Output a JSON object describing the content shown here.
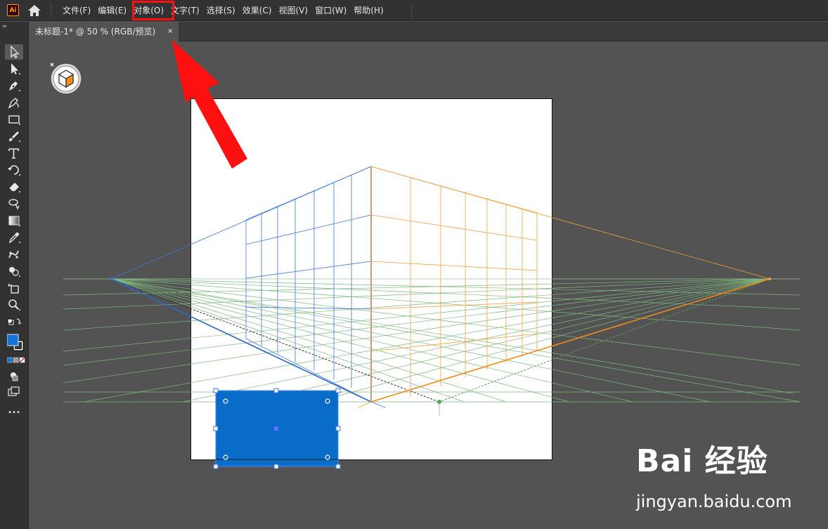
{
  "app": {
    "logo_text": "Ai"
  },
  "menu": {
    "items": [
      "文件(F)",
      "编辑(E)",
      "对象(O)",
      "文字(T)",
      "选择(S)",
      "效果(C)",
      "视图(V)",
      "窗口(W)",
      "帮助(H)"
    ],
    "highlighted_item": "对象(O)"
  },
  "document_tab": {
    "label": "未标题-1* @ 50 % (RGB/预览)",
    "close_glyph": "×"
  },
  "toolbar": {
    "tools": [
      "selection-tool-icon",
      "direct-selection-tool-icon",
      "pen-tool-icon",
      "curvature-tool-icon",
      "rectangle-tool-icon",
      "paintbrush-tool-icon",
      "type-tool-icon",
      "rotate-tool-icon",
      "eraser-tool-icon",
      "lasso-tool-icon",
      "gradient-tool-icon",
      "eyedropper-tool-icon",
      "puppet-warp-tool-icon",
      "shape-builder-tool-icon",
      "artboard-tool-icon",
      "zoom-tool-icon"
    ],
    "fill_color": "#1473d6",
    "stroke_color": "#000000",
    "more_glyph": "•••"
  },
  "colors": {
    "left_grid": "#3d78d8",
    "right_grid": "#f0a040",
    "ground_grid": "#6aaa6a",
    "selected_fill": "#0a6cc9",
    "annotation_red": "#ff1010"
  },
  "watermark": {
    "logo_text": "Bai 经验",
    "url": "jingyan.baidu.com"
  }
}
